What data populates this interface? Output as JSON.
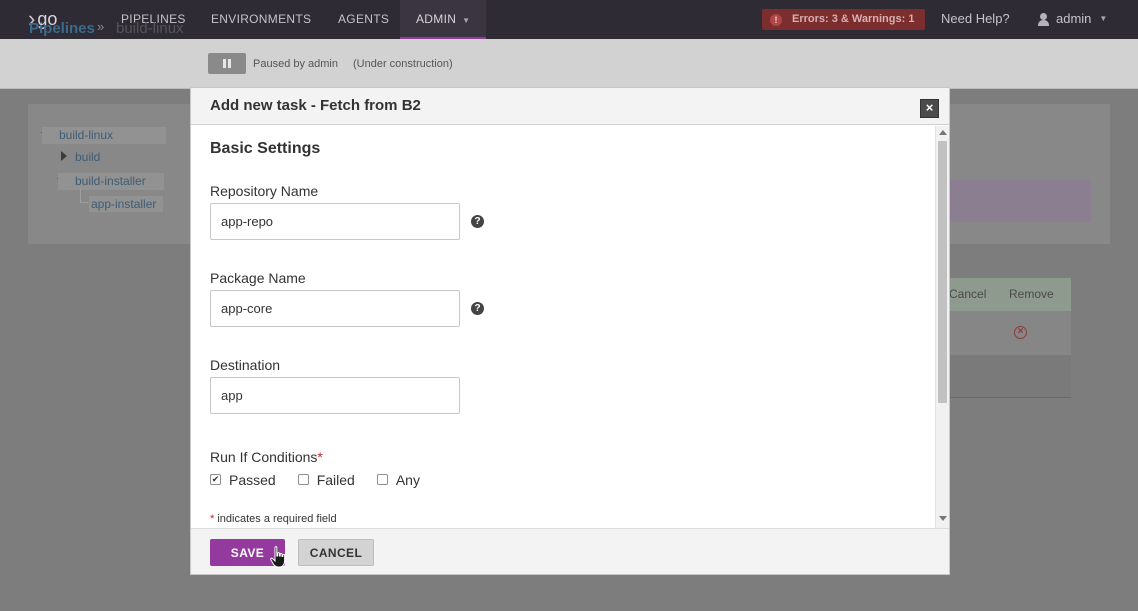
{
  "nav": {
    "logo_text": "go",
    "items": [
      {
        "label": "PIPELINES"
      },
      {
        "label": "ENVIRONMENTS"
      },
      {
        "label": "AGENTS"
      },
      {
        "label": "ADMIN"
      }
    ],
    "errors_badge": "Errors: 3 & Warnings: 1",
    "need_help": "Need Help?",
    "user": "admin"
  },
  "breadcrumb": {
    "root": "Pipelines",
    "separator": "»",
    "current": "build-linux",
    "paused_by": "Paused by admin",
    "status": "(Under construction)"
  },
  "tree": {
    "root": "build-linux",
    "stages": [
      {
        "label": "build"
      },
      {
        "label": "build-installer"
      }
    ],
    "job": "app-installer"
  },
  "tasks_table": {
    "col_cancel": "Cancel",
    "col_remove": "Remove"
  },
  "modal": {
    "title": "Add new task - Fetch from B2",
    "section_title": "Basic Settings",
    "fields": {
      "repository": {
        "label": "Repository Name",
        "value": "app-repo"
      },
      "package": {
        "label": "Package Name",
        "value": "app-core"
      },
      "destination": {
        "label": "Destination",
        "value": "app"
      }
    },
    "run_if": {
      "label": "Run If Conditions",
      "required_mark": "*",
      "options": [
        {
          "label": "Passed",
          "checked": true
        },
        {
          "label": "Failed",
          "checked": false
        },
        {
          "label": "Any",
          "checked": false
        }
      ]
    },
    "required_note": "indicates a required field",
    "buttons": {
      "save": "SAVE",
      "cancel": "CANCEL"
    }
  },
  "colors": {
    "accent": "#943a9e",
    "nav_bg": "#2e2b34",
    "error_bg": "#7c2e2e"
  }
}
